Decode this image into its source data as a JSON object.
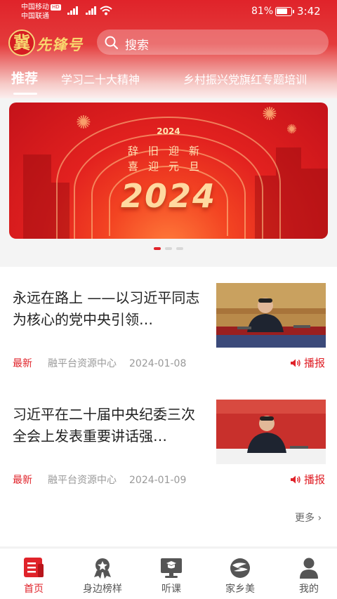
{
  "status_bar": {
    "carrier_1": "中国移动",
    "carrier_1_badge": "HD",
    "carrier_2": "中国联通",
    "battery_percent": "81%",
    "battery_level": 0.81,
    "time": "3:42"
  },
  "header": {
    "logo_seal": "冀",
    "logo_text": "先锋号",
    "search_placeholder": "搜索"
  },
  "tabs": [
    {
      "label": "推荐",
      "active": true
    },
    {
      "label": "学习二十大精神",
      "active": false
    },
    {
      "label": "乡村振兴党旗红专题培训",
      "active": false
    }
  ],
  "banner": {
    "year_small": "2024",
    "slogan_line_1": "辞旧迎新",
    "slogan_line_2": "喜迎元旦",
    "year_big": "2024",
    "slide_count": 3,
    "active_slide": 0
  },
  "news": [
    {
      "title": "永远在路上 ——以习近平同志为核心的党中央引领…",
      "tag": "最新",
      "source": "融平台资源中心",
      "date": "2024-01-08",
      "action": "播报"
    },
    {
      "title": "习近平在二十届中央纪委三次全会上发表重要讲话强…",
      "tag": "最新",
      "source": "融平台资源中心",
      "date": "2024-01-09",
      "action": "播报"
    }
  ],
  "more_label": "更多",
  "bottom_nav": [
    {
      "label": "首页",
      "icon": "home-news-icon",
      "active": true
    },
    {
      "label": "身边榜样",
      "icon": "medal-icon",
      "active": false
    },
    {
      "label": "听课",
      "icon": "lecture-monitor-icon",
      "active": false
    },
    {
      "label": "家乡美",
      "icon": "hometown-icon",
      "active": false
    },
    {
      "label": "我的",
      "icon": "user-icon",
      "active": false
    }
  ],
  "colors": {
    "primary_red": "#e0232a",
    "logo_gold": "#f9d66e"
  }
}
